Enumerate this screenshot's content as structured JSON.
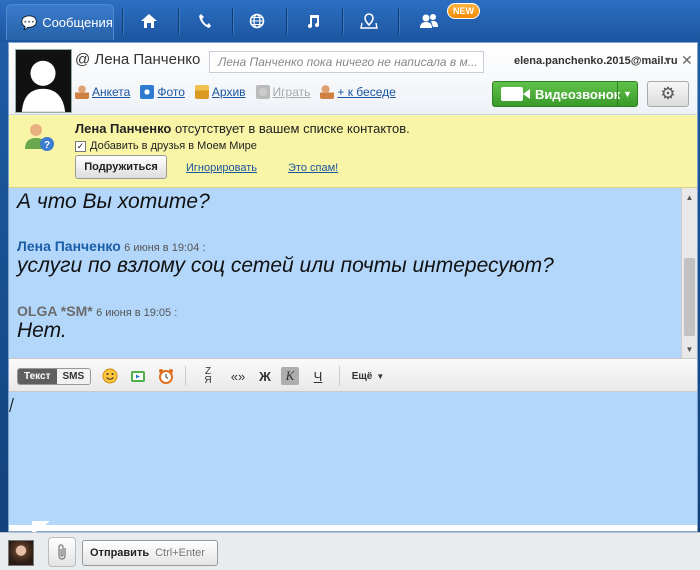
{
  "nav": {
    "messages_label": "Сообщения",
    "new_badge": "NEW",
    "icons": [
      "home-icon",
      "phone-icon",
      "globe-icon",
      "music-icon",
      "map-icon",
      "friends-icon"
    ]
  },
  "header": {
    "contact_name": "@ Лена Панченко",
    "status_text": "Лена Панченко пока ничего не написала в м...",
    "account_email": "elena.panchenko.2015@mail.ru",
    "links": {
      "profile": "Анкета",
      "photo": "Фото",
      "archive": "Архив",
      "play": "Играть",
      "add_to_chat": "+ к беседе"
    },
    "video_call": "Видеозвонок"
  },
  "notice": {
    "name": "Лена Панченко",
    "text": " отсутствует в вашем списке контактов.",
    "checkbox_label": "Добавить в друзья в Моем Мире",
    "add_friend": "Подружиться",
    "ignore": "Игнорировать",
    "spam": "Это спам!"
  },
  "messages": [
    {
      "author": "",
      "time": "",
      "text": "А что Вы хотите?"
    },
    {
      "author": "Лена Панченко",
      "time": "6 июня в 19:04 :",
      "text": "услуги по взлому соц сетей или почты интересуют?"
    },
    {
      "author": "OLGA *SM*",
      "time": "6 июня в 19:05 :",
      "text": "Нет."
    }
  ],
  "toolbar": {
    "text_mode": "Текст",
    "sms_mode": "SMS",
    "quote": "«»",
    "bold": "Ж",
    "italic": "К",
    "underline": "Ч",
    "more": "Ещё"
  },
  "bottom": {
    "send_label": "Отправить",
    "send_shortcut": "Ctrl+Enter"
  },
  "colors": {
    "chat_bg": "#b3d7fb",
    "contact_name_color": "#1a5ea8",
    "self_name_color": "#6b6b6b",
    "notice_bg": "#f9f5a6",
    "video_button": "#4caf3a"
  }
}
